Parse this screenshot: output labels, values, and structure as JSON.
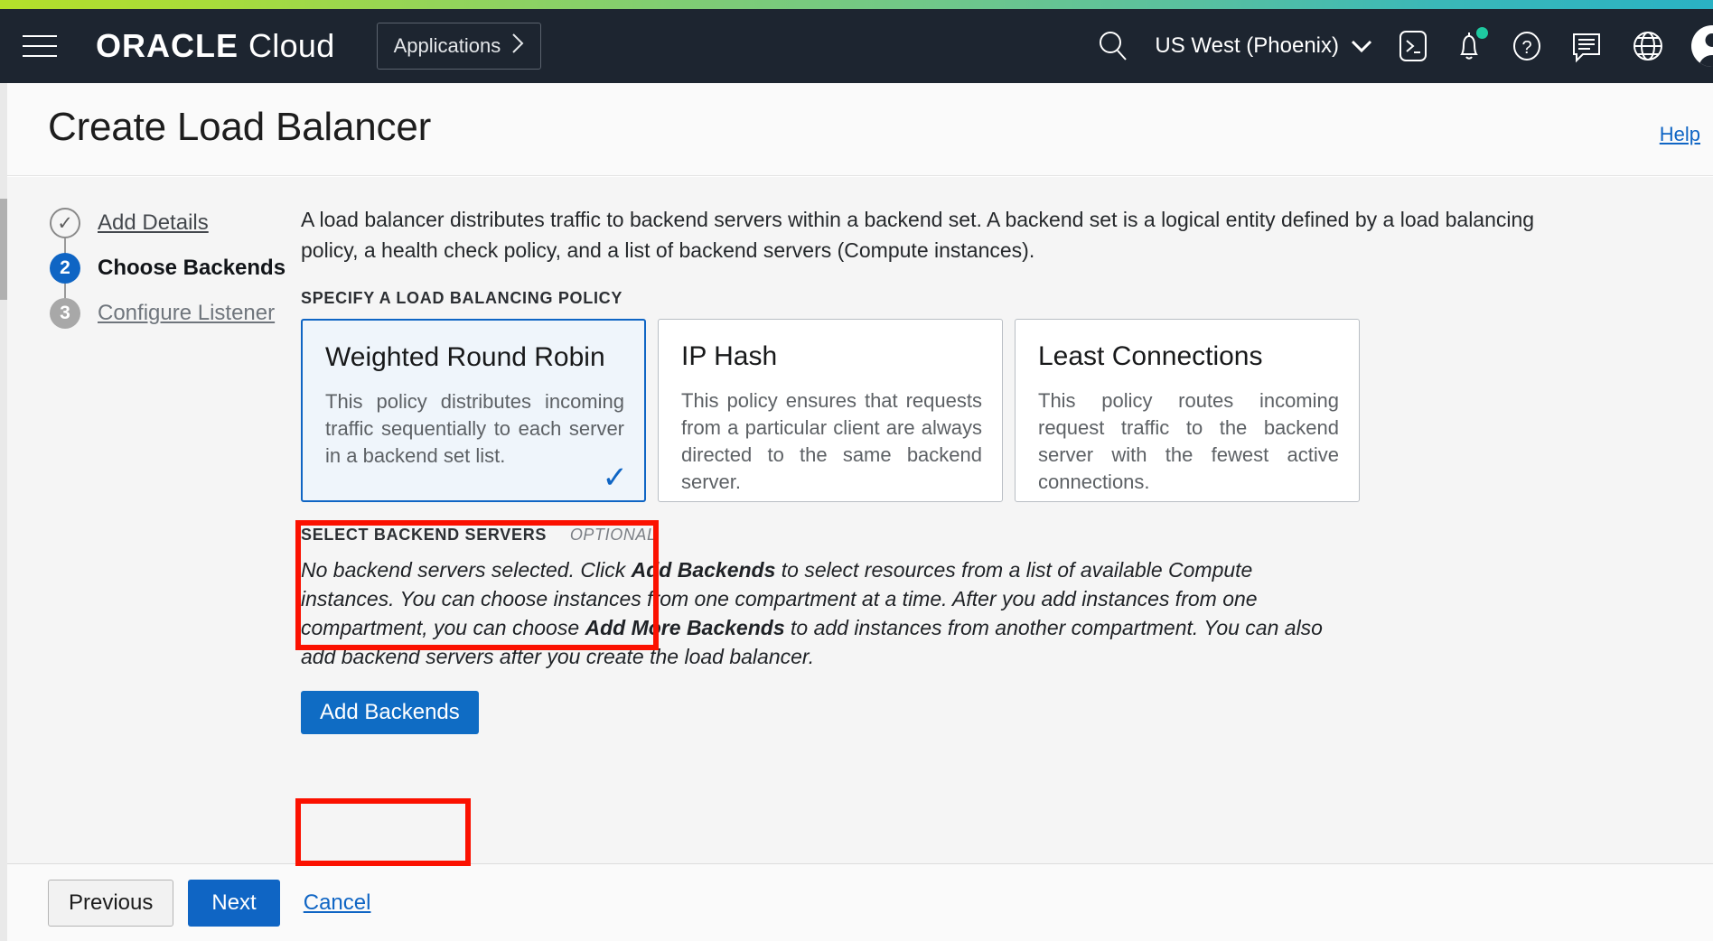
{
  "header": {
    "menu_icon": "hamburger-icon",
    "brand_primary": "ORACLE",
    "brand_secondary": "Cloud",
    "applications_label": "Applications",
    "applications_chevron": "›",
    "search_icon": "search-icon",
    "region": "US West (Phoenix)",
    "region_chevron": "⌄",
    "icons": [
      "cloud-shell-icon",
      "notifications-bell-icon",
      "help-question-icon",
      "feedback-chat-icon",
      "language-globe-icon",
      "user-avatar-icon"
    ]
  },
  "title_bar": {
    "title": "Create Load Balancer",
    "help_label": "Help"
  },
  "stepper": {
    "steps": [
      {
        "marker": "✓",
        "label": "Add Details",
        "state": "done"
      },
      {
        "marker": "2",
        "label": "Choose Backends",
        "state": "current"
      },
      {
        "marker": "3",
        "label": "Configure Listener",
        "state": "todo"
      }
    ]
  },
  "main": {
    "intro": "A load balancer distributes traffic to backend servers within a backend set. A backend set is a logical entity defined by a load balancing policy, a health check policy, and a list of backend servers (Compute instances).",
    "policy_section_label": "SPECIFY A LOAD BALANCING POLICY",
    "policies": [
      {
        "title": "Weighted Round Robin",
        "description": "This policy distributes incoming traffic sequentially to each server in a backend set list.",
        "selected": true,
        "check_glyph": "✓"
      },
      {
        "title": "IP Hash",
        "description": "This policy ensures that requests from a particular client are always directed to the same backend server.",
        "selected": false,
        "check_glyph": ""
      },
      {
        "title": "Least Connections",
        "description": "This policy routes incoming request traffic to the backend server with the fewest active connections.",
        "selected": false,
        "check_glyph": ""
      }
    ],
    "backend_section_label": "SELECT BACKEND SERVERS",
    "backend_section_optional": "OPTIONAL",
    "backend_paragraph_part1": "No backend servers selected. Click ",
    "backend_paragraph_bold1": "Add Backends",
    "backend_paragraph_part2": " to select resources from a list of available Compute instances. You can choose instances from one compartment at a time. After you add instances from one compartment, you can choose ",
    "backend_paragraph_bold2": "Add More Backends",
    "backend_paragraph_part3": " to add instances from another compartment. You can also add backend servers after you create the load balancer.",
    "add_backends_label": "Add Backends"
  },
  "footer": {
    "previous_label": "Previous",
    "next_label": "Next",
    "cancel_label": "Cancel"
  },
  "annotations": {
    "highlight_color": "#fb1100",
    "items": [
      {
        "name": "weighted-round-robin-card-highlight"
      },
      {
        "name": "add-backends-button-highlight"
      }
    ]
  }
}
